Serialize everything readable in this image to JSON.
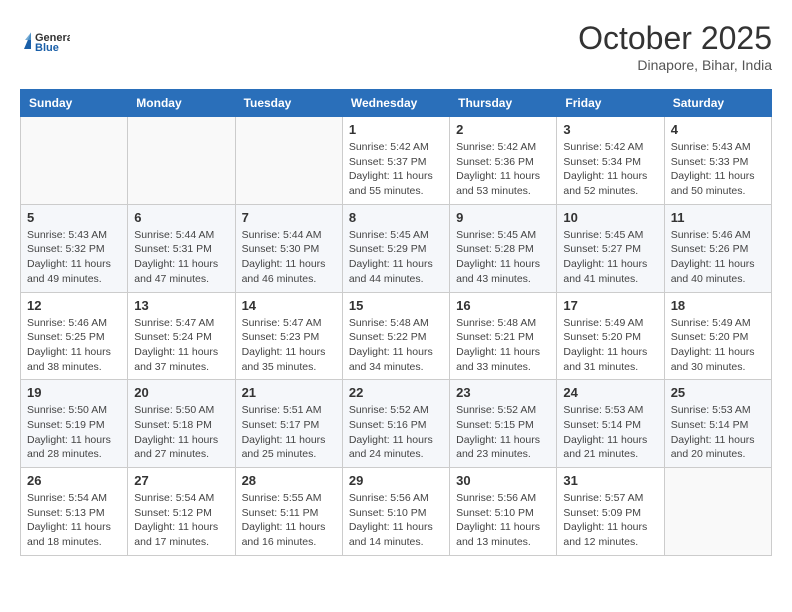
{
  "logo": {
    "line1": "General",
    "line2": "Blue"
  },
  "title": "October 2025",
  "location": "Dinapore, Bihar, India",
  "weekdays": [
    "Sunday",
    "Monday",
    "Tuesday",
    "Wednesday",
    "Thursday",
    "Friday",
    "Saturday"
  ],
  "weeks": [
    [
      {
        "day": "",
        "info": ""
      },
      {
        "day": "",
        "info": ""
      },
      {
        "day": "",
        "info": ""
      },
      {
        "day": "1",
        "info": "Sunrise: 5:42 AM\nSunset: 5:37 PM\nDaylight: 11 hours\nand 55 minutes."
      },
      {
        "day": "2",
        "info": "Sunrise: 5:42 AM\nSunset: 5:36 PM\nDaylight: 11 hours\nand 53 minutes."
      },
      {
        "day": "3",
        "info": "Sunrise: 5:42 AM\nSunset: 5:34 PM\nDaylight: 11 hours\nand 52 minutes."
      },
      {
        "day": "4",
        "info": "Sunrise: 5:43 AM\nSunset: 5:33 PM\nDaylight: 11 hours\nand 50 minutes."
      }
    ],
    [
      {
        "day": "5",
        "info": "Sunrise: 5:43 AM\nSunset: 5:32 PM\nDaylight: 11 hours\nand 49 minutes."
      },
      {
        "day": "6",
        "info": "Sunrise: 5:44 AM\nSunset: 5:31 PM\nDaylight: 11 hours\nand 47 minutes."
      },
      {
        "day": "7",
        "info": "Sunrise: 5:44 AM\nSunset: 5:30 PM\nDaylight: 11 hours\nand 46 minutes."
      },
      {
        "day": "8",
        "info": "Sunrise: 5:45 AM\nSunset: 5:29 PM\nDaylight: 11 hours\nand 44 minutes."
      },
      {
        "day": "9",
        "info": "Sunrise: 5:45 AM\nSunset: 5:28 PM\nDaylight: 11 hours\nand 43 minutes."
      },
      {
        "day": "10",
        "info": "Sunrise: 5:45 AM\nSunset: 5:27 PM\nDaylight: 11 hours\nand 41 minutes."
      },
      {
        "day": "11",
        "info": "Sunrise: 5:46 AM\nSunset: 5:26 PM\nDaylight: 11 hours\nand 40 minutes."
      }
    ],
    [
      {
        "day": "12",
        "info": "Sunrise: 5:46 AM\nSunset: 5:25 PM\nDaylight: 11 hours\nand 38 minutes."
      },
      {
        "day": "13",
        "info": "Sunrise: 5:47 AM\nSunset: 5:24 PM\nDaylight: 11 hours\nand 37 minutes."
      },
      {
        "day": "14",
        "info": "Sunrise: 5:47 AM\nSunset: 5:23 PM\nDaylight: 11 hours\nand 35 minutes."
      },
      {
        "day": "15",
        "info": "Sunrise: 5:48 AM\nSunset: 5:22 PM\nDaylight: 11 hours\nand 34 minutes."
      },
      {
        "day": "16",
        "info": "Sunrise: 5:48 AM\nSunset: 5:21 PM\nDaylight: 11 hours\nand 33 minutes."
      },
      {
        "day": "17",
        "info": "Sunrise: 5:49 AM\nSunset: 5:20 PM\nDaylight: 11 hours\nand 31 minutes."
      },
      {
        "day": "18",
        "info": "Sunrise: 5:49 AM\nSunset: 5:20 PM\nDaylight: 11 hours\nand 30 minutes."
      }
    ],
    [
      {
        "day": "19",
        "info": "Sunrise: 5:50 AM\nSunset: 5:19 PM\nDaylight: 11 hours\nand 28 minutes."
      },
      {
        "day": "20",
        "info": "Sunrise: 5:50 AM\nSunset: 5:18 PM\nDaylight: 11 hours\nand 27 minutes."
      },
      {
        "day": "21",
        "info": "Sunrise: 5:51 AM\nSunset: 5:17 PM\nDaylight: 11 hours\nand 25 minutes."
      },
      {
        "day": "22",
        "info": "Sunrise: 5:52 AM\nSunset: 5:16 PM\nDaylight: 11 hours\nand 24 minutes."
      },
      {
        "day": "23",
        "info": "Sunrise: 5:52 AM\nSunset: 5:15 PM\nDaylight: 11 hours\nand 23 minutes."
      },
      {
        "day": "24",
        "info": "Sunrise: 5:53 AM\nSunset: 5:14 PM\nDaylight: 11 hours\nand 21 minutes."
      },
      {
        "day": "25",
        "info": "Sunrise: 5:53 AM\nSunset: 5:14 PM\nDaylight: 11 hours\nand 20 minutes."
      }
    ],
    [
      {
        "day": "26",
        "info": "Sunrise: 5:54 AM\nSunset: 5:13 PM\nDaylight: 11 hours\nand 18 minutes."
      },
      {
        "day": "27",
        "info": "Sunrise: 5:54 AM\nSunset: 5:12 PM\nDaylight: 11 hours\nand 17 minutes."
      },
      {
        "day": "28",
        "info": "Sunrise: 5:55 AM\nSunset: 5:11 PM\nDaylight: 11 hours\nand 16 minutes."
      },
      {
        "day": "29",
        "info": "Sunrise: 5:56 AM\nSunset: 5:10 PM\nDaylight: 11 hours\nand 14 minutes."
      },
      {
        "day": "30",
        "info": "Sunrise: 5:56 AM\nSunset: 5:10 PM\nDaylight: 11 hours\nand 13 minutes."
      },
      {
        "day": "31",
        "info": "Sunrise: 5:57 AM\nSunset: 5:09 PM\nDaylight: 11 hours\nand 12 minutes."
      },
      {
        "day": "",
        "info": ""
      }
    ]
  ]
}
